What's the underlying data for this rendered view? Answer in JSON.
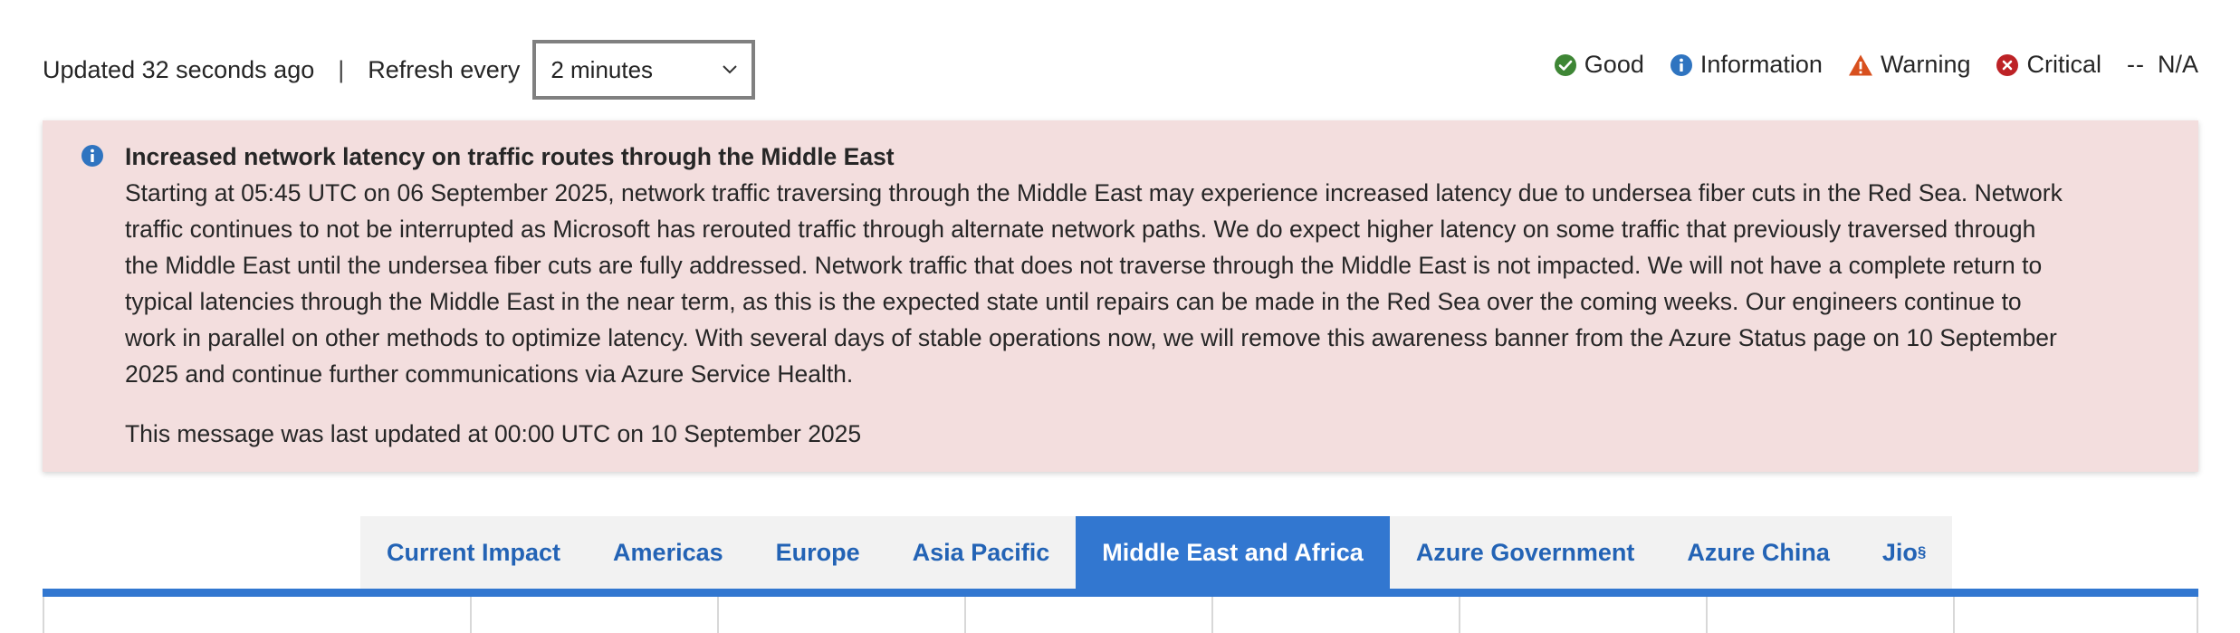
{
  "status_bar": {
    "updated_text": "Updated 32 seconds ago",
    "separator": "|",
    "refresh_label": "Refresh every",
    "refresh_selected": "2 minutes"
  },
  "legend": {
    "good": "Good",
    "information": "Information",
    "warning": "Warning",
    "critical": "Critical",
    "na_symbol": "--",
    "na": "N/A"
  },
  "icons": {
    "good": "check-circle-icon",
    "information": "info-circle-icon",
    "warning": "warning-triangle-icon",
    "critical": "x-circle-icon",
    "dropdown": "chevron-down-icon"
  },
  "colors": {
    "good": "#3e8635",
    "information": "#2f74c0",
    "warning": "#d8501e",
    "critical": "#bd2226",
    "banner_bg": "#f3dede",
    "tab_active_bg": "#3277d0",
    "tab_text": "#2363b5"
  },
  "banner": {
    "title": "Increased network latency on traffic routes through the Middle East",
    "body_lines": [
      "Starting at 05:45 UTC on 06 September 2025, network traffic traversing through the Middle East may experience increased latency due to undersea fiber cuts in the Red Sea. Network",
      "traffic continues to not be interrupted as Microsoft has rerouted traffic through alternate network paths. We do expect higher latency on some traffic that previously traversed through",
      "the Middle East until the undersea fiber cuts are fully addressed. Network traffic that does not traverse through the Middle East is not impacted. We will not have a complete return to",
      "typical latencies through the Middle East in the near term, as this is the expected state until repairs can be made in the Red Sea over the coming weeks. Our engineers continue to",
      "work in parallel on other methods to optimize latency. With several days of stable operations now, we will remove this awareness banner from the Azure Status page on 10 September",
      "2025 and continue further communications via Azure Service Health."
    ],
    "last_updated": "This message was last updated at 00:00 UTC on 10 September 2025"
  },
  "tabs": [
    {
      "label": "Current Impact",
      "active": false
    },
    {
      "label": "Americas",
      "active": false
    },
    {
      "label": "Europe",
      "active": false
    },
    {
      "label": "Asia Pacific",
      "active": false
    },
    {
      "label": "Middle East and Africa",
      "active": true
    },
    {
      "label": "Azure Government",
      "active": false
    },
    {
      "label": "Azure China",
      "active": false
    },
    {
      "label": "Jio",
      "sup": "§",
      "active": false
    }
  ]
}
